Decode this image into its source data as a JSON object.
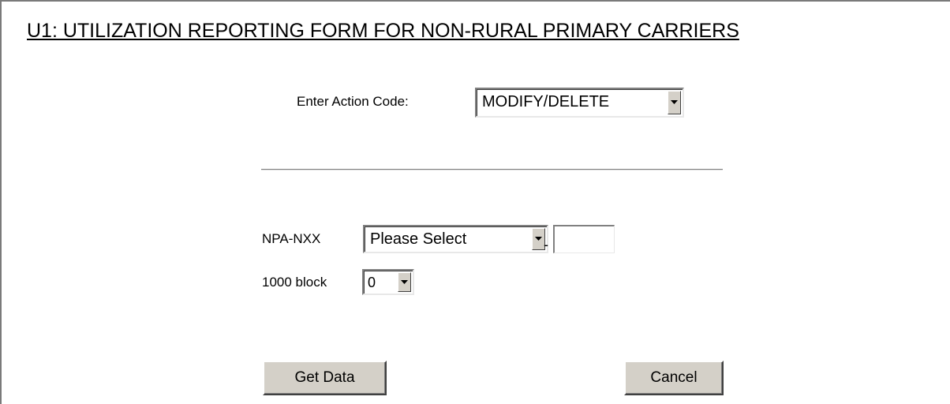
{
  "form": {
    "title": "U1: UTILIZATION REPORTING FORM FOR NON-RURAL PRIMARY CARRIERS",
    "action_code": {
      "label": "Enter Action Code:",
      "selected": "MODIFY/DELETE"
    },
    "npa_nxx": {
      "label": "NPA-NXX",
      "selected": "Please Select",
      "separator": "-",
      "nxx_value": ""
    },
    "block": {
      "label": "1000 block",
      "selected": "0"
    },
    "buttons": {
      "get_data": "Get Data",
      "cancel": "Cancel"
    }
  },
  "icons": {
    "dropdown_arrow": "chevron-down-icon"
  },
  "colors": {
    "button_face": "#d4d0c8",
    "background": "#ffffff",
    "text": "#000000"
  }
}
